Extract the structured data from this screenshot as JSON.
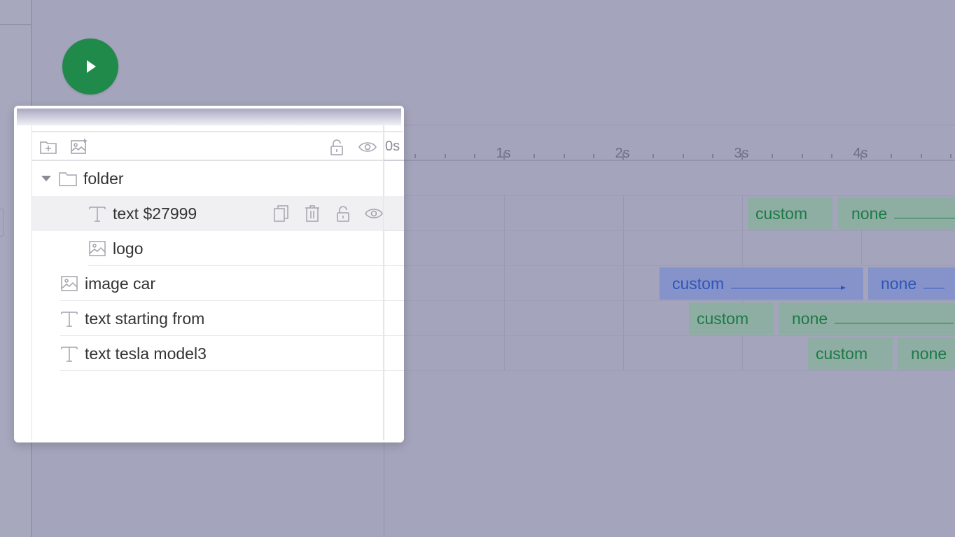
{
  "colors": {
    "play_button": "#1f8a4a",
    "custom_transition": "#8eaea4",
    "custom_text": "#1b7a45",
    "move_transition": "#8593ca",
    "move_text": "#2f56b7"
  },
  "play_button": {
    "icon": "play-icon"
  },
  "toolbar": {
    "left_icons": [
      "add-folder-icon",
      "add-image-icon"
    ],
    "right_icons": [
      "unlock-icon",
      "eye-icon"
    ]
  },
  "timeline": {
    "ticks": [
      "0s",
      "1s",
      "2s",
      "3s",
      "4s"
    ],
    "tracks": [
      {
        "bars": []
      },
      {
        "bars": [
          {
            "label": "custom",
            "color": "green"
          },
          {
            "label": "none",
            "color": "green",
            "has_line": true
          }
        ]
      },
      {
        "bars": []
      },
      {
        "bars": [
          {
            "label": "custom",
            "color": "blue",
            "has_arrow": true
          },
          {
            "label": "none",
            "color": "blue",
            "has_line": true
          }
        ]
      },
      {
        "bars": [
          {
            "label": "custom",
            "color": "green"
          },
          {
            "label": "none",
            "color": "green",
            "has_line": true
          }
        ]
      },
      {
        "bars": [
          {
            "label": "custom",
            "color": "green"
          },
          {
            "label": "none",
            "color": "green"
          }
        ]
      }
    ]
  },
  "layers": [
    {
      "name": "folder",
      "type": "folder",
      "expanded": true,
      "indent": 0
    },
    {
      "name": "text $27999",
      "type": "text",
      "indent": 1,
      "selected": true,
      "actions": [
        "duplicate-icon",
        "trash-icon",
        "unlock-icon",
        "eye-icon"
      ]
    },
    {
      "name": "logo",
      "type": "image",
      "indent": 1
    },
    {
      "name": "image car",
      "type": "image",
      "indent": 0
    },
    {
      "name": "text starting from",
      "type": "text",
      "indent": 0
    },
    {
      "name": "text tesla model3",
      "type": "text",
      "indent": 0
    }
  ]
}
